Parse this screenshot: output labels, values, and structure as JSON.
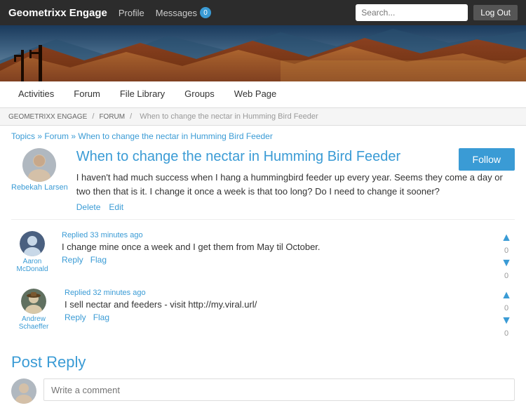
{
  "header": {
    "brand": "Geometrixx Engage",
    "nav": {
      "profile": "Profile",
      "messages": "Messages",
      "messages_count": "0",
      "logout": "Log Out",
      "search_placeholder": "Search..."
    }
  },
  "subnav": {
    "items": [
      {
        "label": "Activities",
        "id": "activities"
      },
      {
        "label": "Forum",
        "id": "forum"
      },
      {
        "label": "File Library",
        "id": "file-library"
      },
      {
        "label": "Groups",
        "id": "groups"
      },
      {
        "label": "Web Page",
        "id": "web-page"
      }
    ]
  },
  "breadcrumb": {
    "parts": [
      {
        "label": "Geometrixx Engage",
        "href": "#"
      },
      {
        "label": "Forum",
        "href": "#"
      },
      {
        "label": "When to change the nectar in Humming Bird Feeder",
        "href": "#"
      }
    ]
  },
  "topic_path": "Topics » Forum » When to change the nectar in Humming Bird Feeder",
  "post": {
    "title": "When to change the nectar in Humming Bird Feeder",
    "follow_label": "Follow",
    "author": "Rebekah Larsen",
    "body": "I haven't had much success when I hang a hummingbird feeder up every year. Seems they come a day or two then that is it. I change it once a week is that too long? Do I need to change it sooner?",
    "delete_label": "Delete",
    "edit_label": "Edit"
  },
  "replies": [
    {
      "author": "Aaron McDonald",
      "time": "Replied 33 minutes ago",
      "text": "I change mine once a week and I get them from May til October.",
      "reply_label": "Reply",
      "flag_label": "Flag",
      "votes_up": 0,
      "votes_down": 0
    },
    {
      "author": "Andrew Schaeffer",
      "time": "Replied 32 minutes ago",
      "text": "I sell nectar and feeders - visit http://my.viral.url/",
      "reply_label": "Reply",
      "flag_label": "Flag",
      "votes_up": 0,
      "votes_down": 0
    }
  ],
  "post_reply": {
    "title": "Post Reply",
    "placeholder": "Write a comment"
  }
}
